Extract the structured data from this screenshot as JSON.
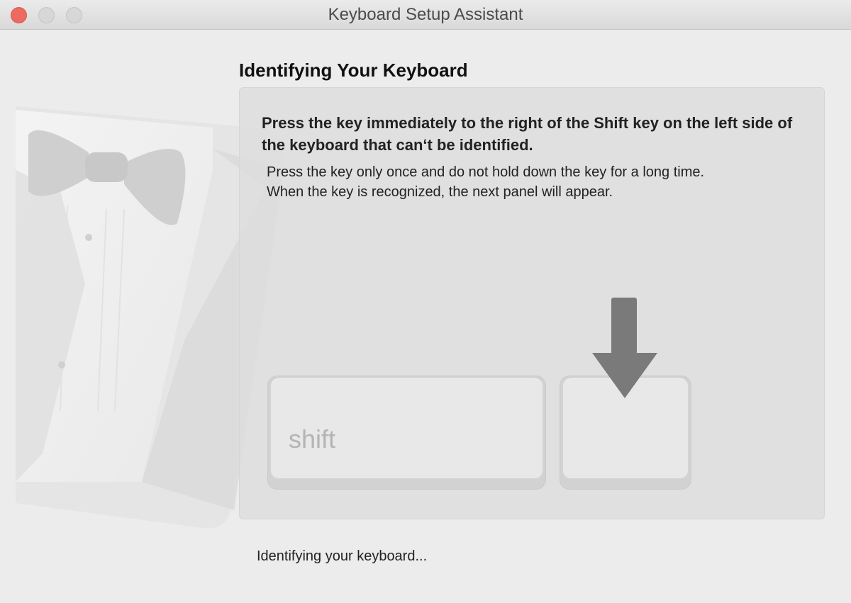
{
  "window": {
    "title": "Keyboard Setup Assistant",
    "close_color": "#ee6a5f",
    "inactive_button_color": "#d7d7d7"
  },
  "content": {
    "heading": "Identifying Your Keyboard",
    "instruction": "Press the key immediately to the right of the Shift key on the left side of the keyboard that can‘t be identified.",
    "detail_line_1": "Press the key only once and do not hold down the key for a long time.",
    "detail_line_2": "When the key is recognized, the next panel will appear.",
    "shift_key_label": "shift",
    "status": "Identifying your keyboard..."
  },
  "icons": {
    "illustration": "tuxedo-illustration",
    "arrow": "down-arrow-icon"
  }
}
